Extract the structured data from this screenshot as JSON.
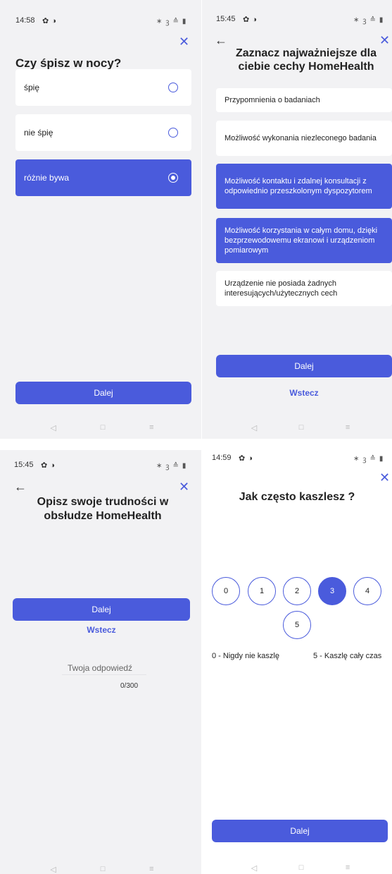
{
  "colors": {
    "accent": "#4a5bdc",
    "background_grey": "#f2f2f4",
    "card": "#ffffff"
  },
  "screen1": {
    "status": {
      "time": "14:58",
      "icons": [
        "gear-icon",
        "app-icon",
        "bluetooth-icon",
        "mute-icon",
        "wifi-icon",
        "battery-icon"
      ]
    },
    "close": "✕",
    "title": "Czy śpisz w nocy?",
    "options": [
      {
        "label": "śpię",
        "selected": false
      },
      {
        "label": "nie śpię",
        "selected": false
      },
      {
        "label": "różnie bywa",
        "selected": true
      }
    ],
    "next": "Dalej"
  },
  "screen2": {
    "status": {
      "time": "15:45"
    },
    "back": "←",
    "close": "✕",
    "title": "Zaznacz najważniejsze dla ciebie cechy HomeHealth",
    "options": [
      {
        "label": "Przypomnienia o badaniach",
        "selected": false
      },
      {
        "label": "Możliwość wykonania niezleconego badania",
        "selected": false
      },
      {
        "label": "Możliwość kontaktu i zdalnej konsultacji z odpowiednio przeszkolonym dyspozytorem",
        "selected": true
      },
      {
        "label": "Możliwość korzystania w całym domu, dzięki bezprzewodowemu ekranowi i urządzeniom pomiarowym",
        "selected": true
      },
      {
        "label": "Urządzenie nie posiada żadnych interesujących/użytecznych cech",
        "selected": false
      }
    ],
    "next": "Dalej",
    "back_link": "Wstecz"
  },
  "screen3": {
    "status": {
      "time": "15:45"
    },
    "back": "←",
    "close": "✕",
    "title": "Opisz swoje trudności w obsłudze HomeHealth",
    "placeholder": "Twoja odpowiedź",
    "counter": "0/300",
    "next": "Dalej",
    "back_link": "Wstecz"
  },
  "screen4": {
    "status": {
      "time": "14:59"
    },
    "close": "✕",
    "title": "Jak często kaszlesz ?",
    "scale": [
      "0",
      "1",
      "2",
      "3",
      "4",
      "5"
    ],
    "selected": "3",
    "min_label": "0 - Nigdy nie kaszlę",
    "max_label": "5 - Kaszlę cały czas",
    "next": "Dalej"
  },
  "nav": {
    "back": "◁",
    "home": "□",
    "menu": "≡"
  }
}
